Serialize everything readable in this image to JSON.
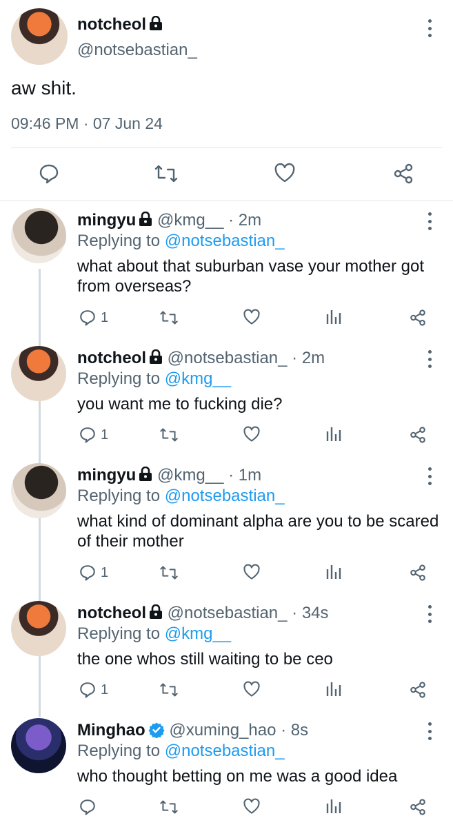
{
  "main_tweet": {
    "name": "notcheol",
    "handle": "@notsebastian_",
    "text": "aw shit.",
    "timestamp": "09:46 PM · 07 Jun 24"
  },
  "replies": [
    {
      "name": "mingyu",
      "handle": "@kmg__",
      "time": "· 2m",
      "replying_label": "Replying to",
      "replying_to": "@notsebastian_",
      "text": "what about that suburban vase your mother got from overseas?",
      "reply_count": "1"
    },
    {
      "name": "notcheol",
      "handle": "@notsebastian_",
      "time": "· 2m",
      "replying_label": "Replying to",
      "replying_to": "@kmg__",
      "text": "you want me to fucking die?",
      "reply_count": "1"
    },
    {
      "name": "mingyu",
      "handle": "@kmg__",
      "time": "· 1m",
      "replying_label": "Replying to",
      "replying_to": "@notsebastian_",
      "text": "what kind of dominant alpha are you to be scared of their mother",
      "reply_count": "1"
    },
    {
      "name": "notcheol",
      "handle": "@notsebastian_",
      "time": "· 34s",
      "replying_label": "Replying to",
      "replying_to": "@kmg__",
      "text": "the one whos still waiting to be ceo",
      "reply_count": "1"
    },
    {
      "name": "Minghao",
      "handle": "@xuming_hao",
      "time": "· 8s",
      "replying_label": "Replying to",
      "replying_to": "@notsebastian_",
      "text": "who thought betting on me was a good idea",
      "reply_count": ""
    }
  ],
  "icons": [
    "lock-icon",
    "verified-badge-icon",
    "reply-icon",
    "retweet-icon",
    "like-icon",
    "analytics-icon",
    "share-icon",
    "more-options-icon"
  ],
  "colors": {
    "accent": "#1d9bf0",
    "secondary_text": "#536471",
    "divider": "#e1e8ed"
  }
}
